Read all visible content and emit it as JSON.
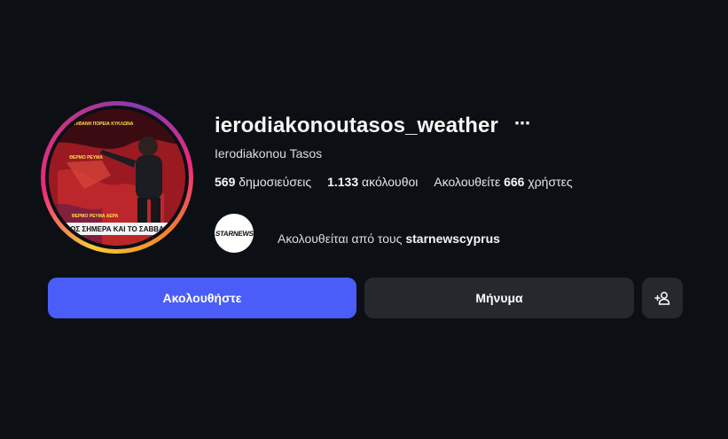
{
  "profile": {
    "username": "ierodiakonoutasos_weather",
    "full_name": "Ierodiakonou Tasos",
    "more_icon": "⋯",
    "stats": {
      "posts_count": "569",
      "posts_label": "δημοσιεύσεις",
      "followers_count": "1.133",
      "followers_label": "ακόλουθοι",
      "following_prefix": "Ακολουθείτε",
      "following_count": "666",
      "following_label": "χρήστες"
    },
    "avatar_text": {
      "top": "ΠΙΘΑΝΗ ΠΟΡΕΙΑ ΚΥΚΛΩΝΑ",
      "mid": "ΘΕΡΜΟ ΡΕΥΜΑ",
      "lower": "ΘΕΡΜΟ ΡΕΥΜΑ ΑΕΡΑ",
      "ticker": "ΟΣ ΣΗΜΕΡΑ ΚΑΙ ΤΟ ΣΑΒΒΑ"
    }
  },
  "followed_by": {
    "prefix": "Ακολουθείται από τους",
    "account": "starnewscyprus",
    "logo_text": "STARNEWS"
  },
  "actions": {
    "follow_label": "Ακολουθήστε",
    "message_label": "Μήνυμα",
    "suggest_icon": "add-person-icon"
  },
  "colors": {
    "background": "#0c1014",
    "follow_button": "#4a5df9",
    "secondary_button": "#25292e"
  }
}
